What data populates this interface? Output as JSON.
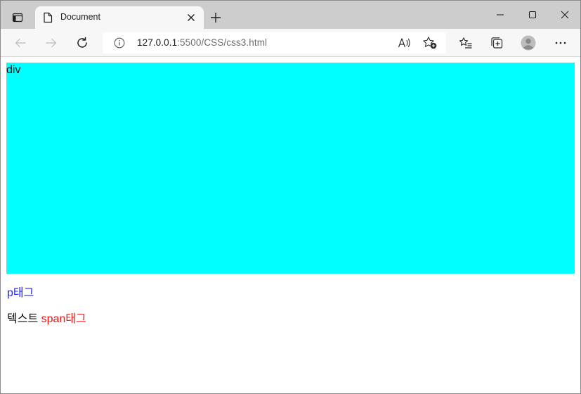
{
  "browser": {
    "tab": {
      "title": "Document"
    },
    "address": {
      "host": "127.0.0.1",
      "path": ":5500/CSS/css3.html"
    }
  },
  "icons": {
    "tab_actions": "tab-actions-icon",
    "favicon": "document-icon",
    "tab_close": "close-icon",
    "new_tab": "plus-icon",
    "minimize": "minimize-icon",
    "maximize": "maximize-icon",
    "close_window": "close-icon",
    "back": "arrow-left-icon",
    "forward": "arrow-right-icon",
    "reload": "refresh-icon",
    "site_info": "info-icon",
    "read_aloud": "read-aloud-icon",
    "add_favorite": "star-plus-icon",
    "favorites": "favorites-list-icon",
    "collections": "collections-icon",
    "profile": "profile-avatar-icon",
    "more": "more-horizontal-icon"
  },
  "page": {
    "div_text": "div",
    "p_text": "p태그",
    "plain_text": "텍스트 ",
    "span_text": "span태그"
  },
  "colors": {
    "div_background": "#00ffff",
    "p_color": "#2222ee",
    "span_color": "#ee1111",
    "tabstrip": "#cdcdcd",
    "toolbar": "#f7f7f7"
  }
}
